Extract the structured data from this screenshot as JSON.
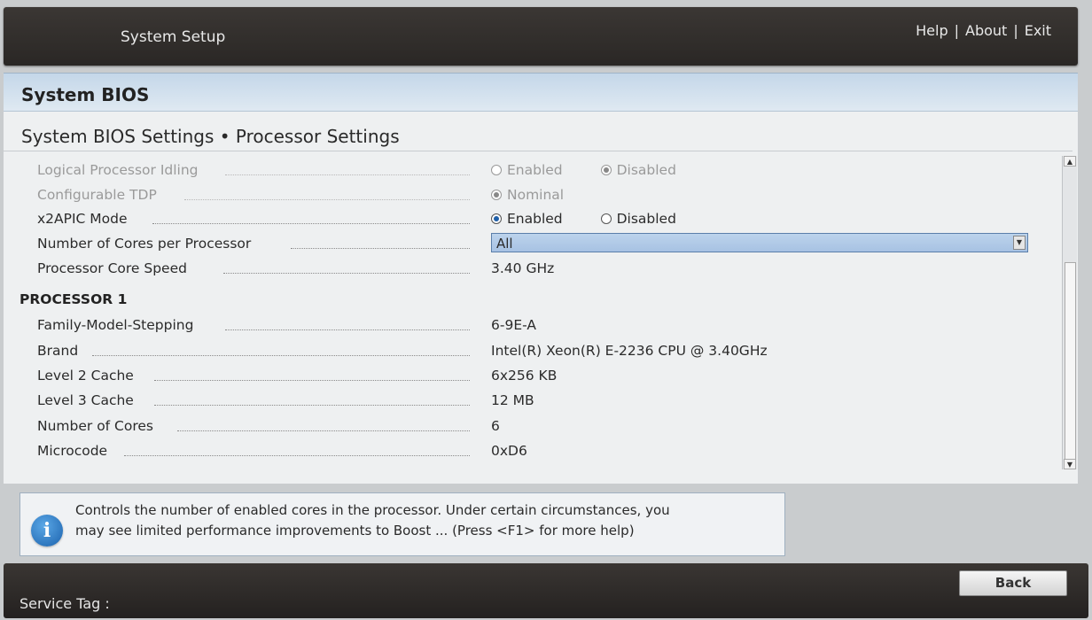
{
  "topbar": {
    "title": "System Setup",
    "links": {
      "help": "Help",
      "about": "About",
      "exit": "Exit",
      "separator": "|"
    }
  },
  "section": {
    "header": "System BIOS"
  },
  "page": {
    "title": "System BIOS Settings • Processor Settings"
  },
  "settings": {
    "logical_processor_idling": {
      "label": "Logical Processor Idling",
      "opt1": "Enabled",
      "opt2": "Disabled",
      "selected": "Disabled",
      "disabled": true
    },
    "configurable_tdp": {
      "label": "Configurable TDP",
      "opt1": "Nominal",
      "selected": "Nominal",
      "disabled": true
    },
    "x2apic_mode": {
      "label": "x2APIC Mode",
      "opt1": "Enabled",
      "opt2": "Disabled",
      "selected": "Enabled"
    },
    "cores_per_processor": {
      "label": "Number of Cores per Processor",
      "value": "All"
    },
    "core_speed": {
      "label": "Processor Core Speed",
      "value": "3.40 GHz"
    }
  },
  "processor1": {
    "heading": "PROCESSOR 1",
    "rows": [
      {
        "label": "Family-Model-Stepping",
        "value": "6-9E-A"
      },
      {
        "label": "Brand",
        "value": "Intel(R) Xeon(R) E-2236 CPU @ 3.40GHz"
      },
      {
        "label": "Level 2 Cache",
        "value": "6x256 KB"
      },
      {
        "label": "Level 3 Cache",
        "value": "12 MB"
      },
      {
        "label": "Number of Cores",
        "value": "6"
      },
      {
        "label": "Microcode",
        "value": "0xD6"
      }
    ]
  },
  "help": {
    "icon": "info-icon",
    "line1": "Controls the number of enabled cores in the processor. Under certain circumstances, you",
    "line2": "may see limited performance improvements to Boost ... (Press <F1> for more help)"
  },
  "footer": {
    "service_tag_label": "Service Tag :",
    "back_label": "Back"
  },
  "colors": {
    "accent": "#1f5fa8",
    "header_bg": "#c4d7e9",
    "dropdown_bg": "#a7c2e3"
  }
}
